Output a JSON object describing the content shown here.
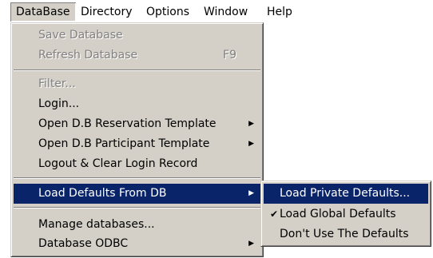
{
  "menubar": {
    "items": [
      {
        "label": "DataBase"
      },
      {
        "label": "Directory"
      },
      {
        "label": "Options"
      },
      {
        "label": "Window"
      },
      {
        "label": "Help"
      }
    ]
  },
  "database_menu": {
    "items": [
      {
        "label": "Save Database",
        "enabled": false
      },
      {
        "label": "Refresh Database",
        "shortcut": "F9",
        "enabled": false
      },
      {
        "label": "Filter...",
        "enabled": false
      },
      {
        "label": "Login...",
        "enabled": true
      },
      {
        "label": "Open D.B Reservation Template",
        "submenu": true
      },
      {
        "label": "Open D.B Participant Template",
        "submenu": true
      },
      {
        "label": "Logout & Clear Login Record"
      },
      {
        "label": "Load Defaults From DB",
        "submenu": true,
        "highlighted": true
      },
      {
        "label": "Manage databases..."
      },
      {
        "label": "Database ODBC",
        "submenu": true
      }
    ]
  },
  "load_defaults_submenu": {
    "items": [
      {
        "label": "Load Private Defaults...",
        "highlighted": true
      },
      {
        "label": "Load Global Defaults",
        "checked": true
      },
      {
        "label": "Don't Use The Defaults"
      }
    ]
  },
  "icons": {
    "submenu_arrow": "triangle-right-icon",
    "check": "checkmark-icon"
  },
  "colors": {
    "menu_bg": "#d4d0c8",
    "highlight_bg": "#0a246a",
    "disabled_text": "#808080"
  }
}
